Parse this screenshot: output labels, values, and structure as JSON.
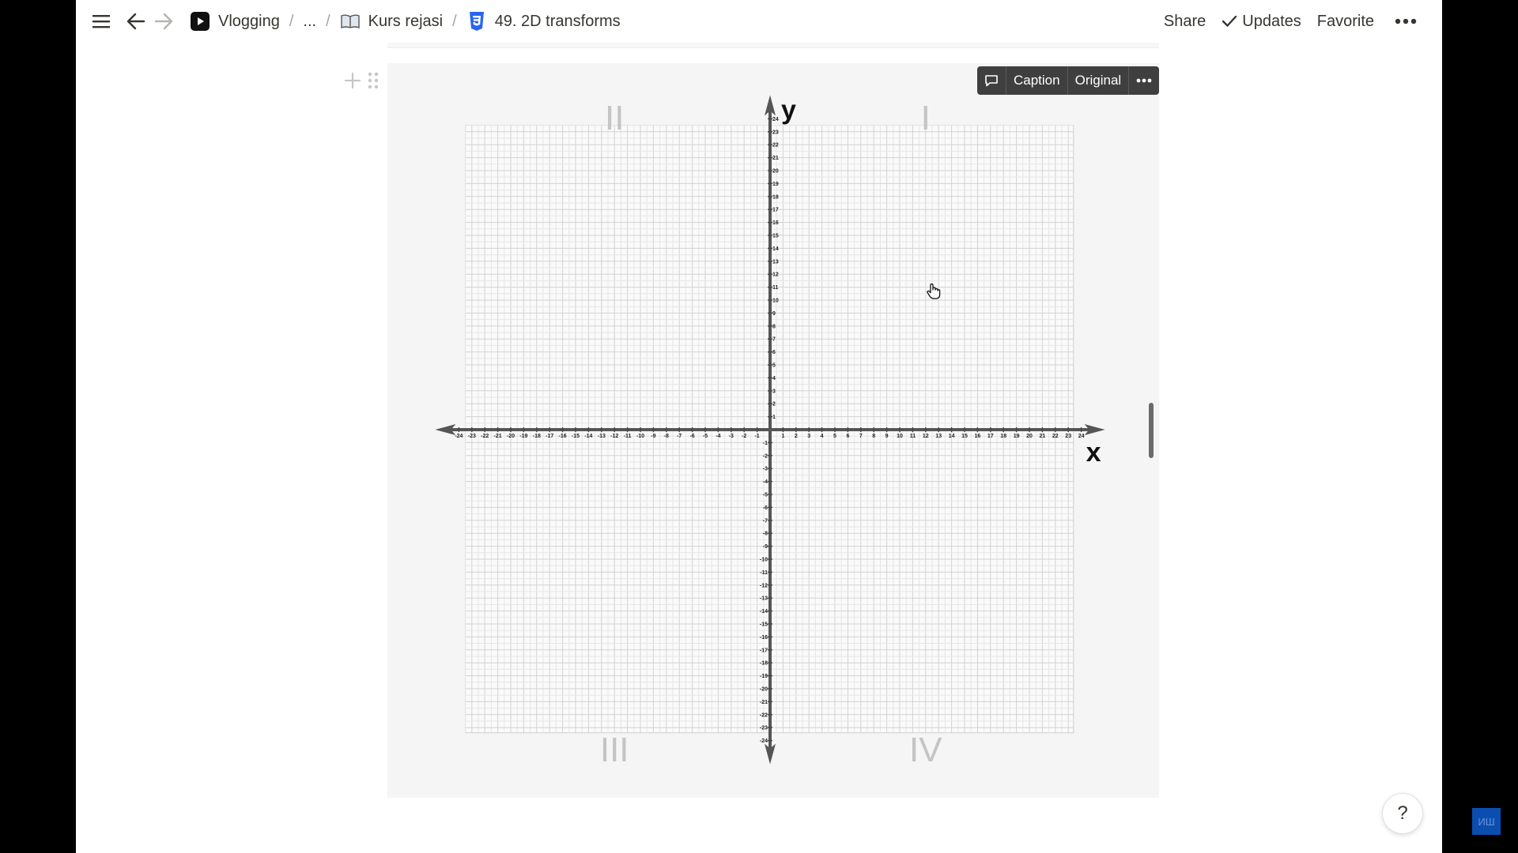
{
  "topbar": {
    "breadcrumbs": [
      {
        "label": "Vlogging",
        "icon": "youtube-icon"
      },
      {
        "label": "...",
        "icon": ""
      },
      {
        "label": "Kurs rejasi",
        "icon": "book-icon"
      },
      {
        "label": "49. 2D transforms",
        "icon": "css3-icon"
      }
    ],
    "separator": "/",
    "share_label": "Share",
    "updates_label": "Updates",
    "favorite_label": "Favorite"
  },
  "image_toolbar": {
    "caption_label": "Caption",
    "original_label": "Original"
  },
  "help_label": "?",
  "corner_badge": "ИШ",
  "chart_data": {
    "type": "scatter",
    "title": "",
    "xlabel": "x",
    "ylabel": "y",
    "xlim": [
      -24,
      24
    ],
    "ylim": [
      -24,
      24
    ],
    "xticks": [
      -24,
      -23,
      -22,
      -21,
      -20,
      -19,
      -18,
      -17,
      -16,
      -15,
      -14,
      -13,
      -12,
      -11,
      -10,
      -9,
      -8,
      -7,
      -6,
      -5,
      -4,
      -3,
      -2,
      -1,
      1,
      2,
      3,
      4,
      5,
      6,
      7,
      8,
      9,
      10,
      11,
      12,
      13,
      14,
      15,
      16,
      17,
      18,
      19,
      20,
      21,
      22,
      23,
      24
    ],
    "yticks": [
      -24,
      -23,
      -22,
      -21,
      -20,
      -19,
      -18,
      -17,
      -16,
      -15,
      -14,
      -13,
      -12,
      -11,
      -10,
      -9,
      -8,
      -7,
      -6,
      -5,
      -4,
      -3,
      -2,
      -1,
      1,
      2,
      3,
      4,
      5,
      6,
      7,
      8,
      9,
      10,
      11,
      12,
      13,
      14,
      15,
      16,
      17,
      18,
      19,
      20,
      21,
      22,
      23,
      24
    ],
    "grid": true,
    "quadrant_labels": [
      {
        "label": "I",
        "quadrant": 1
      },
      {
        "label": "II",
        "quadrant": 2
      },
      {
        "label": "III",
        "quadrant": 3
      },
      {
        "label": "IV",
        "quadrant": 4
      }
    ],
    "series": []
  }
}
